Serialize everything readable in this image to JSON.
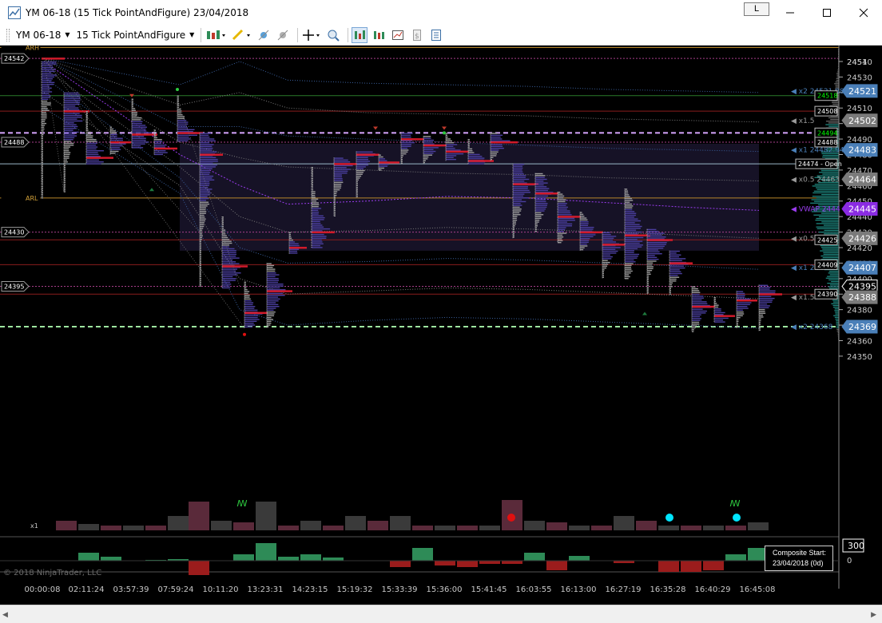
{
  "window": {
    "title": "YM 06-18 (15 Tick PointAndFigure)  23/04/2018",
    "link_button": "L",
    "minimize_icon": "minimize-icon",
    "maximize_icon": "maximize-icon",
    "close_icon": "close-icon"
  },
  "toolbar": {
    "instrument": "YM 06-18",
    "bar_type": "15 Tick PointAndFigure",
    "icons": [
      "chart-style-icon",
      "drawing-tool-icon",
      "strategy-icon",
      "indicator-icon",
      "crosshair-icon",
      "zoom-icon",
      "bar-chart-icon",
      "candlestick-icon",
      "data-box-icon",
      "properties-icon",
      "hide-panel-icon"
    ]
  },
  "colors": {
    "background": "#000000",
    "profile_gray": "#9c9c9c",
    "profile_value_area": "#4b3fa0",
    "poc_red": "#d11a2a",
    "vwap": "#9b3cf0",
    "volume_up": "#2e8b57",
    "volume_down": "#9b1c1c",
    "composite_teal": "#1f8f86"
  },
  "price_axis": {
    "ticks": [
      "24540",
      "24530",
      "24520",
      "24510",
      "24500",
      "24490",
      "24480",
      "24470",
      "24460",
      "24450",
      "24440",
      "24430",
      "24420",
      "24410",
      "24400",
      "24390",
      "24380",
      "24370",
      "24360",
      "24350"
    ],
    "top_partial": "2451",
    "highlight_labels": [
      {
        "text": "24521",
        "color": "#4a7fb8"
      },
      {
        "text": "24502",
        "color": "#7a7a7a"
      },
      {
        "text": "24483",
        "color": "#4a7fb8"
      },
      {
        "text": "24464",
        "color": "#7a7a7a"
      },
      {
        "text": "24445",
        "color": "#8a2be2"
      },
      {
        "text": "24426",
        "color": "#7a7a7a"
      },
      {
        "text": "24407",
        "color": "#4a7fb8"
      },
      {
        "text": "24395",
        "color": "#000000"
      },
      {
        "text": "24388",
        "color": "#7a7a7a"
      },
      {
        "text": "24369",
        "color": "#4a7fb8"
      }
    ]
  },
  "band_labels": [
    {
      "text": "x2 24521.08",
      "color": "#4a7fb8"
    },
    {
      "text": "x1.5",
      "color": "#9a9a9a"
    },
    {
      "text": "x1 24482.94",
      "color": "#4a7fb8"
    },
    {
      "text": "x0.5 24463",
      "color": "#9a9a9a"
    },
    {
      "text": "VWAP 2444",
      "color": "#9b3cf0"
    },
    {
      "text": "x0.5",
      "color": "#9a9a9a"
    },
    {
      "text": "x1 24407",
      "color": "#4a7fb8"
    },
    {
      "text": "x1.5",
      "color": "#9a9a9a"
    },
    {
      "text": "x2 24368",
      "color": "#4a7fb8"
    }
  ],
  "level_tags": [
    {
      "text": "24518",
      "color": "#00ff00"
    },
    {
      "text": "24508",
      "color": "#ffffff"
    },
    {
      "text": "24494",
      "color": "#00ff00"
    },
    {
      "text": "24488",
      "color": "#ffffff"
    },
    {
      "text": "24474 - Open",
      "color": "#ffffff"
    },
    {
      "text": "24425",
      "color": "#ffffff"
    },
    {
      "text": "24409",
      "color": "#ffffff"
    },
    {
      "text": "24390",
      "color": "#ffffff"
    }
  ],
  "left_tags": [
    {
      "text": "ARH"
    },
    {
      "text": "24542"
    },
    {
      "text": "24488"
    },
    {
      "text": "ARL"
    },
    {
      "text": "24430"
    },
    {
      "text": "24395"
    }
  ],
  "time_axis": [
    "00:00:08",
    "02:11:24",
    "03:57:39",
    "07:59:24",
    "10:11:20",
    "13:23:31",
    "14:23:15",
    "15:19:32",
    "15:33:39",
    "15:36:00",
    "15:41:45",
    "16:03:55",
    "16:13:00",
    "16:27:19",
    "16:35:28",
    "16:40:29",
    "16:45:08"
  ],
  "volume_panel": {
    "max_label": "300",
    "zero_label": "0",
    "scale_label": "x1"
  },
  "composite": {
    "line1": "Composite Start:",
    "line2": "23/04/2018 (0d)"
  },
  "copyright": "© 2018 NinjaTrader, LLC"
}
